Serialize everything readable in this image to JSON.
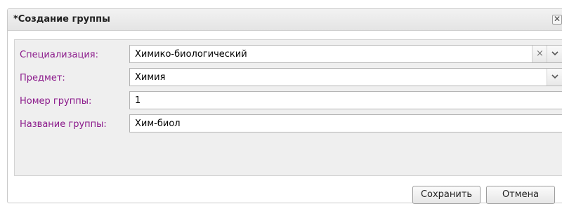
{
  "dialog": {
    "title": "*Создание группы",
    "close_glyph": "✕"
  },
  "form": {
    "specialization": {
      "label": "Специализация:",
      "value": "Химико-биологический"
    },
    "subject": {
      "label": "Предмет:",
      "value": "Химия"
    },
    "group_number": {
      "label": "Номер группы:",
      "value": "1"
    },
    "group_name": {
      "label": "Название группы:",
      "value": "Хим-биол"
    }
  },
  "buttons": {
    "save": "Сохранить",
    "cancel": "Отмена"
  },
  "icons": {
    "clear": "×",
    "dropdown": "⌄"
  },
  "colors": {
    "label": "#8b1a8b",
    "title_bar": "#e9e9e9",
    "form_panel": "#efefef"
  }
}
